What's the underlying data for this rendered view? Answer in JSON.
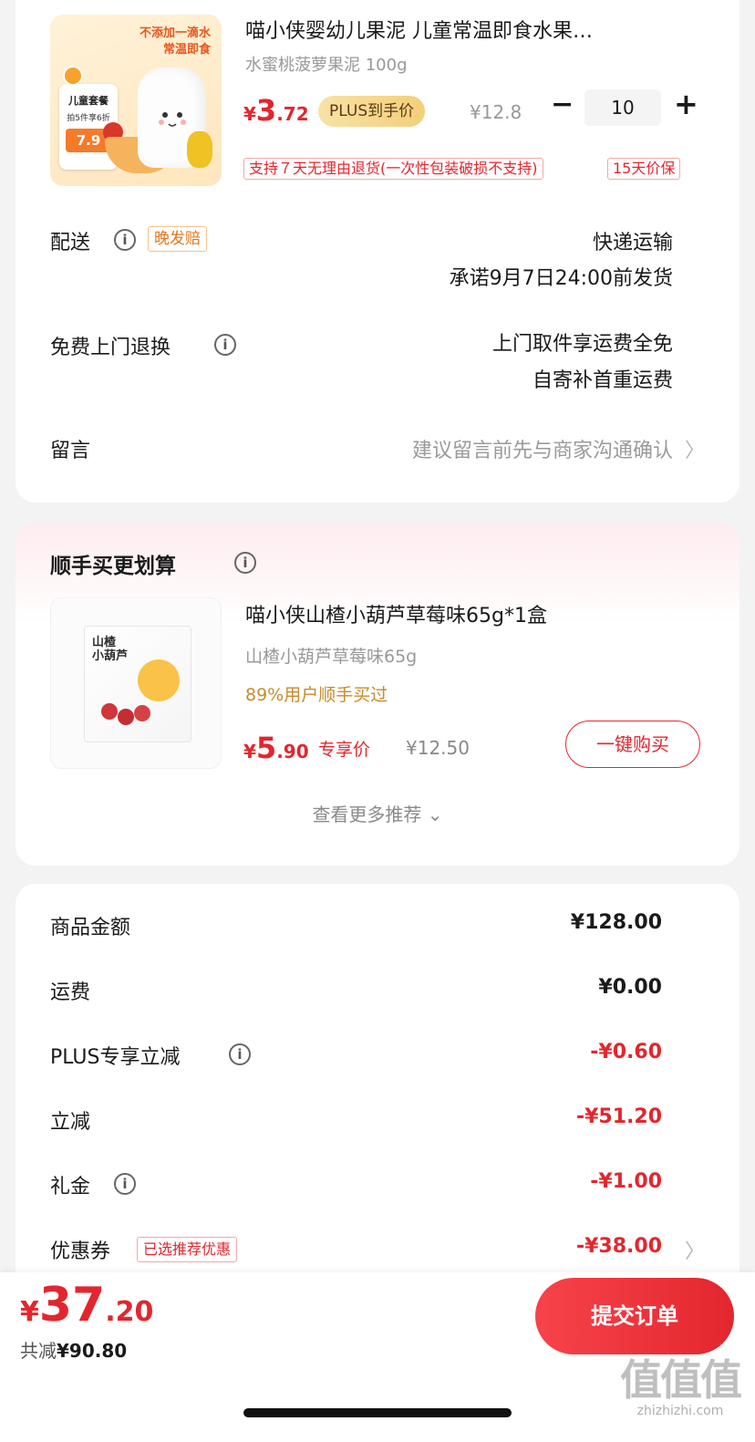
{
  "product": {
    "image_tag_line1": "不添加一滴水",
    "image_tag_line2": "常温即食",
    "image_kit_title": "儿童套餐",
    "image_kit_sub": "拍5件享6折",
    "image_kit_price": "7.9",
    "title": "喵小侠婴幼儿果泥 儿童常温即食水果…",
    "spec": "水蜜桃菠萝果泥 100g",
    "price_symbol": "¥",
    "price_int": "3",
    "price_dec": ".72",
    "plus_label": "PLUS到手价",
    "original_price": "¥12.8",
    "minus_label": "−",
    "quantity": "10",
    "plus_btn_label": "+",
    "return_tag": "支持７天无理由退货(一次性包装破损不支持)",
    "price_protect_tag": "15天价保"
  },
  "delivery": {
    "label": "配送",
    "info_icon": "ⓘ",
    "late_tag": "晚发赔",
    "method": "快递运输",
    "promise": "承诺9月7日24:00前发货"
  },
  "free_return": {
    "label": "免费上门退换",
    "line1": "上门取件享运费全免",
    "line2": "自寄补首重运费"
  },
  "message": {
    "label": "留言",
    "placeholder": "建议留言前先与商家沟通确认",
    "chevron": "〉"
  },
  "addon": {
    "section_title": "顺手买更划算",
    "image_title": "山楂\n小葫芦",
    "title": "喵小侠山楂小葫芦草莓味65g*1盒",
    "spec": "山楂小葫芦草莓味65g",
    "stat": "89%用户顺手买过",
    "price_symbol": "¥",
    "price_int": "5",
    "price_dec": ".90",
    "exclusive_label": "专享价",
    "original_price": "¥12.50",
    "buy_button": "一键购买",
    "see_more": "查看更多推荐",
    "see_more_chevron": "⌄"
  },
  "summary": {
    "rows": [
      {
        "label": "商品金额",
        "value": "¥128.00"
      },
      {
        "label": "运费",
        "value": "¥0.00"
      },
      {
        "label": "PLUS专享立减",
        "value": "-¥0.60"
      },
      {
        "label": "立减",
        "value": "-¥51.20"
      },
      {
        "label": "礼金",
        "value": "-¥1.00"
      },
      {
        "label": "优惠券",
        "value": "-¥38.00"
      }
    ],
    "coupon_tag": "已选推荐优惠"
  },
  "bottom": {
    "total_symbol": "¥",
    "total_int": "37",
    "total_dec": ".20",
    "saved_label": "共减",
    "saved_value": "¥90.80",
    "submit_button": "提交订单"
  },
  "watermark": {
    "glyphs": "值值值",
    "url": "zhizhizhi.com"
  },
  "colors": {
    "accent_red": "#e3262e",
    "plus_gold": "#f3cf79",
    "stat_gold": "#c98a2a"
  }
}
